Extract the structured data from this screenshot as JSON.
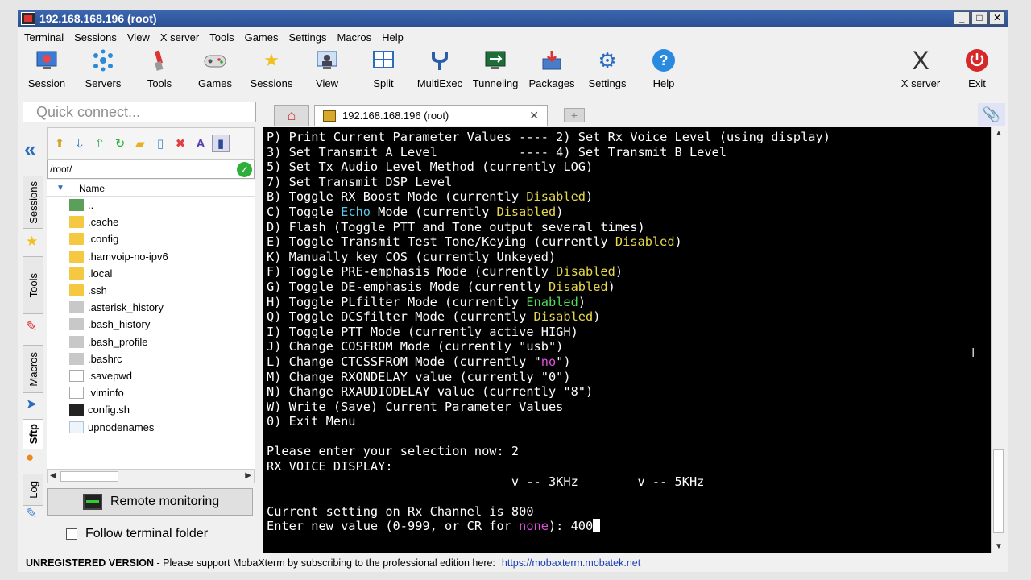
{
  "window": {
    "title": "192.168.168.196 (root)"
  },
  "menu": [
    "Terminal",
    "Sessions",
    "View",
    "X server",
    "Tools",
    "Games",
    "Settings",
    "Macros",
    "Help"
  ],
  "toolbar": {
    "session": "Session",
    "servers": "Servers",
    "tools": "Tools",
    "games": "Games",
    "sessions": "Sessions",
    "view": "View",
    "split": "Split",
    "multiexec": "MultiExec",
    "tunneling": "Tunneling",
    "packages": "Packages",
    "settings": "Settings",
    "help": "Help",
    "xserver": "X server",
    "exit": "Exit"
  },
  "quick_connect": {
    "placeholder": "Quick connect..."
  },
  "tab": {
    "label": "192.168.168.196 (root)"
  },
  "side_tabs": {
    "sessions": "Sessions",
    "tools": "Tools",
    "macros": "Macros",
    "sftp": "Sftp",
    "log": "Log"
  },
  "sftp": {
    "path": "/root/",
    "column_name": "Name",
    "files": [
      {
        "name": "..",
        "type": "up"
      },
      {
        "name": ".cache",
        "type": "folder"
      },
      {
        "name": ".config",
        "type": "folder"
      },
      {
        "name": ".hamvoip-no-ipv6",
        "type": "folder"
      },
      {
        "name": ".local",
        "type": "folder"
      },
      {
        "name": ".ssh",
        "type": "folder"
      },
      {
        "name": ".asterisk_history",
        "type": "hidden"
      },
      {
        "name": ".bash_history",
        "type": "hidden"
      },
      {
        "name": ".bash_profile",
        "type": "hidden"
      },
      {
        "name": ".bashrc",
        "type": "hidden"
      },
      {
        "name": ".savepwd",
        "type": "doc"
      },
      {
        "name": ".viminfo",
        "type": "doc"
      },
      {
        "name": "config.sh",
        "type": "sh"
      },
      {
        "name": "upnodenames",
        "type": "blank"
      }
    ],
    "remote_monitoring": "Remote monitoring",
    "follow_folder": "Follow terminal folder"
  },
  "terminal": {
    "lines": [
      [
        [
          "P) Print Current Parameter Values ---- 2) Set Rx Voice Level (using display)",
          ""
        ]
      ],
      [
        [
          "3) Set Transmit A Level           ---- 4) Set Transmit B Level",
          ""
        ]
      ],
      [
        [
          "5) Set Tx Audio Level Method (currently LOG)",
          ""
        ]
      ],
      [
        [
          "7) Set Transmit DSP Level",
          ""
        ]
      ],
      [
        [
          "B) Toggle RX Boost Mode (currently ",
          ""
        ],
        [
          "Disabled",
          "yel"
        ],
        [
          ")",
          ""
        ]
      ],
      [
        [
          "C) Toggle ",
          ""
        ],
        [
          "Echo",
          "cyan"
        ],
        [
          " Mode (currently ",
          ""
        ],
        [
          "Disabled",
          "yel"
        ],
        [
          ")",
          ""
        ]
      ],
      [
        [
          "D) Flash (Toggle PTT and Tone output several times)",
          ""
        ]
      ],
      [
        [
          "E) Toggle Transmit Test Tone/Keying (currently ",
          ""
        ],
        [
          "Disabled",
          "yel"
        ],
        [
          ")",
          ""
        ]
      ],
      [
        [
          "K) Manually key COS (currently Unkeyed)",
          ""
        ]
      ],
      [
        [
          "F) Toggle PRE-emphasis Mode (currently ",
          ""
        ],
        [
          "Disabled",
          "yel"
        ],
        [
          ")",
          ""
        ]
      ],
      [
        [
          "G) Toggle DE-emphasis Mode (currently ",
          ""
        ],
        [
          "Disabled",
          "yel"
        ],
        [
          ")",
          ""
        ]
      ],
      [
        [
          "H) Toggle PLfilter Mode (currently ",
          ""
        ],
        [
          "Enabled",
          "green"
        ],
        [
          ")",
          ""
        ]
      ],
      [
        [
          "Q) Toggle DCSfilter Mode (currently ",
          ""
        ],
        [
          "Disabled",
          "yel"
        ],
        [
          ")",
          ""
        ]
      ],
      [
        [
          "I) Toggle PTT Mode (currently active HIGH)",
          ""
        ]
      ],
      [
        [
          "J) Change COSFROM Mode (currently \"usb\")",
          ""
        ]
      ],
      [
        [
          "L) Change CTCSSFROM Mode (currently \"",
          ""
        ],
        [
          "no",
          "mag"
        ],
        [
          "\")",
          ""
        ]
      ],
      [
        [
          "M) Change RXONDELAY value (currently \"0\")",
          ""
        ]
      ],
      [
        [
          "N) Change RXAUDIODELAY value (currently \"8\")",
          ""
        ]
      ],
      [
        [
          "W) Write (Save) Current Parameter Values",
          ""
        ]
      ],
      [
        [
          "0) Exit Menu",
          ""
        ]
      ],
      [
        [
          "",
          ""
        ]
      ],
      [
        [
          "Please enter your selection now: 2",
          ""
        ]
      ],
      [
        [
          "RX VOICE DISPLAY:",
          ""
        ]
      ],
      [
        [
          "                                 v -- 3KHz        v -- 5KHz",
          ""
        ]
      ],
      [
        [
          "",
          ""
        ]
      ],
      [
        [
          "Current setting on Rx Channel is 800",
          ""
        ]
      ],
      [
        [
          "Enter new value (0-999, or CR for ",
          ""
        ],
        [
          "none",
          "mag"
        ],
        [
          "): 400",
          ""
        ]
      ]
    ]
  },
  "status": {
    "label": "UNREGISTERED VERSION",
    "message": " -  Please support MobaXterm by subscribing to the professional edition here:",
    "link": "https://mobaxterm.mobatek.net"
  }
}
